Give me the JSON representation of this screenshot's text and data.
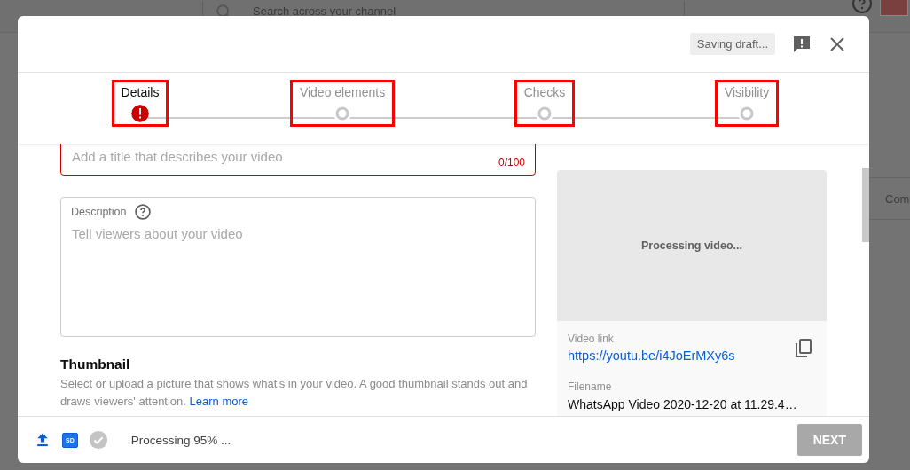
{
  "background": {
    "search": {
      "placeholder": "Search across your channel"
    },
    "side_text": "Com"
  },
  "dialog": {
    "status_chip": "Saving draft...",
    "steps": [
      {
        "label": "Details",
        "kind": "error",
        "selected": true,
        "highlighted": true
      },
      {
        "label": "Video elements",
        "kind": "pending",
        "selected": false,
        "highlighted": true
      },
      {
        "label": "Checks",
        "kind": "pending",
        "selected": false,
        "highlighted": true
      },
      {
        "label": "Visibility",
        "kind": "pending",
        "selected": false,
        "highlighted": true
      }
    ],
    "title_field": {
      "placeholder": "Add a title that describes your video",
      "counter": "0/100",
      "error": true
    },
    "description_field": {
      "label": "Description",
      "placeholder": "Tell viewers about your video"
    },
    "thumbnail": {
      "heading": "Thumbnail",
      "text": "Select or upload a picture that shows what's in your video. A good thumbnail stands out and draws viewers' attention.",
      "link": "Learn more"
    },
    "preview": {
      "status": "Processing video...",
      "video_link_label": "Video link",
      "video_link": "https://youtu.be/i4JoErMXy6s",
      "filename_label": "Filename",
      "filename": "WhatsApp Video 2020-12-20 at 11.29.4…"
    },
    "footer": {
      "quality_badge": "SD",
      "progress_text": "Processing 95% ...",
      "next_button": {
        "label": "NEXT",
        "disabled": true
      }
    }
  }
}
